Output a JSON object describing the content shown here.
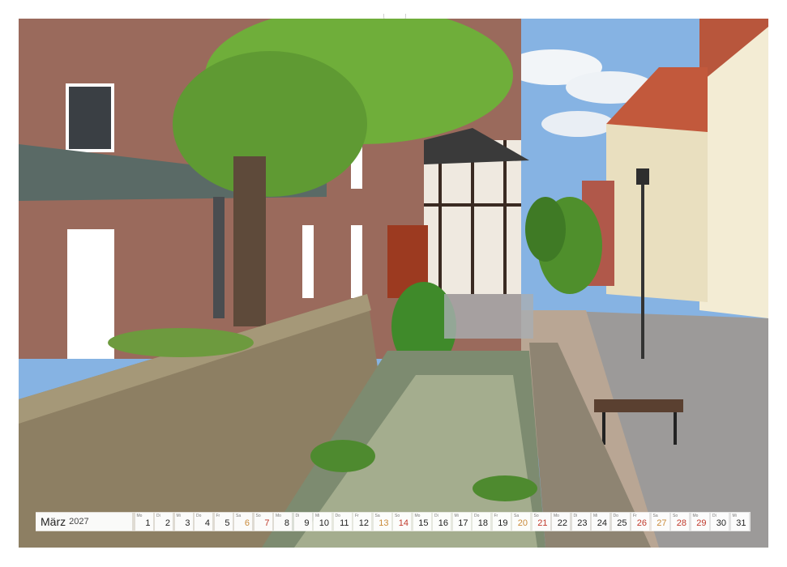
{
  "calendar": {
    "month": "März",
    "year": "2027",
    "days": [
      {
        "n": "1",
        "wd": "Mo",
        "type": "week"
      },
      {
        "n": "2",
        "wd": "Di",
        "type": "week"
      },
      {
        "n": "3",
        "wd": "Mi",
        "type": "week"
      },
      {
        "n": "4",
        "wd": "Do",
        "type": "week"
      },
      {
        "n": "5",
        "wd": "Fr",
        "type": "week"
      },
      {
        "n": "6",
        "wd": "Sa",
        "type": "sat"
      },
      {
        "n": "7",
        "wd": "So",
        "type": "sun"
      },
      {
        "n": "8",
        "wd": "Mo",
        "type": "week"
      },
      {
        "n": "9",
        "wd": "Di",
        "type": "week"
      },
      {
        "n": "10",
        "wd": "Mi",
        "type": "week"
      },
      {
        "n": "11",
        "wd": "Do",
        "type": "week"
      },
      {
        "n": "12",
        "wd": "Fr",
        "type": "week"
      },
      {
        "n": "13",
        "wd": "Sa",
        "type": "sat"
      },
      {
        "n": "14",
        "wd": "So",
        "type": "sun"
      },
      {
        "n": "15",
        "wd": "Mo",
        "type": "week"
      },
      {
        "n": "16",
        "wd": "Di",
        "type": "week"
      },
      {
        "n": "17",
        "wd": "Mi",
        "type": "week"
      },
      {
        "n": "18",
        "wd": "Do",
        "type": "week"
      },
      {
        "n": "19",
        "wd": "Fr",
        "type": "week"
      },
      {
        "n": "20",
        "wd": "Sa",
        "type": "sat"
      },
      {
        "n": "21",
        "wd": "So",
        "type": "sun"
      },
      {
        "n": "22",
        "wd": "Mo",
        "type": "week"
      },
      {
        "n": "23",
        "wd": "Di",
        "type": "week"
      },
      {
        "n": "24",
        "wd": "Mi",
        "type": "week"
      },
      {
        "n": "25",
        "wd": "Do",
        "type": "week"
      },
      {
        "n": "26",
        "wd": "Fr",
        "type": "sun"
      },
      {
        "n": "27",
        "wd": "Sa",
        "type": "sat"
      },
      {
        "n": "28",
        "wd": "So",
        "type": "sun"
      },
      {
        "n": "29",
        "wd": "Mo",
        "type": "sun"
      },
      {
        "n": "30",
        "wd": "Di",
        "type": "week"
      },
      {
        "n": "31",
        "wd": "Mi",
        "type": "week"
      }
    ]
  }
}
